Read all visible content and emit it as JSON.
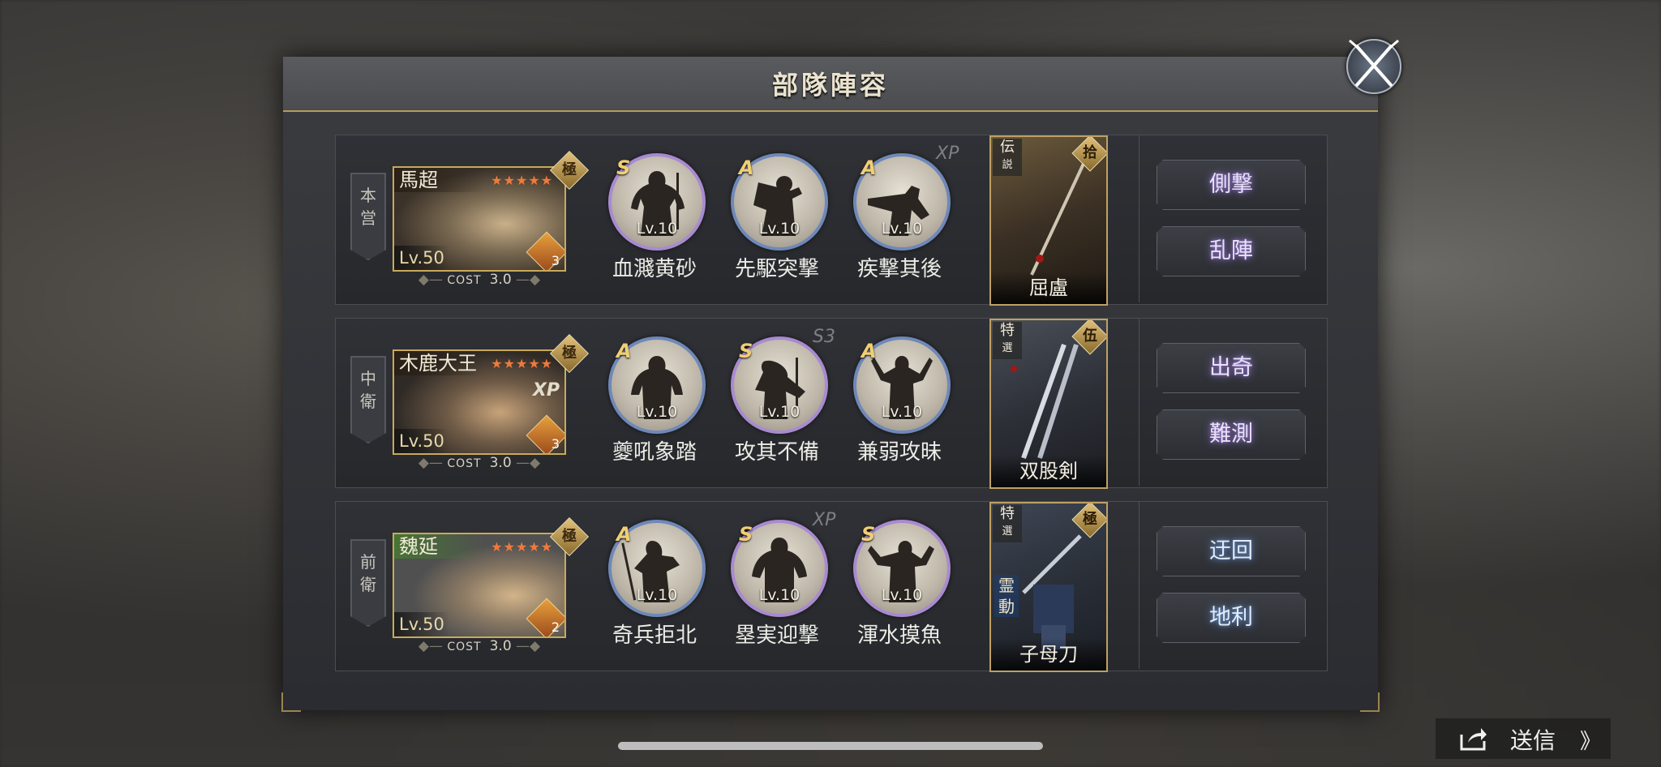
{
  "dialog": {
    "title": "部隊陣容"
  },
  "rows": [
    {
      "position": [
        "本",
        "営"
      ],
      "general": {
        "name": "馬超",
        "level": "Lv.50",
        "stars": "★★★★★",
        "rank_badge": "極",
        "rank_num": "3",
        "xp": "",
        "name_color": "#5a3a22"
      },
      "cost": {
        "label": "COST",
        "value": "3.0"
      },
      "skills": [
        {
          "grade": "S",
          "level": "Lv.10",
          "name": "血濺黄砂"
        },
        {
          "grade": "A",
          "level": "Lv.10",
          "name": "先駆突撃"
        },
        {
          "grade": "A",
          "level": "Lv.10",
          "name": "疾撃其後"
        }
      ],
      "skill_note": "XP",
      "weapon": {
        "name": "屈盧",
        "type_top": "伝",
        "type_bottom": "説",
        "rank": "拾",
        "extra": ""
      },
      "tactics": [
        "側撃",
        "乱陣"
      ]
    },
    {
      "position": [
        "中",
        "衛"
      ],
      "general": {
        "name": "木鹿大王",
        "level": "Lv.50",
        "stars": "★★★★★",
        "rank_badge": "極",
        "rank_num": "3",
        "xp": "XP"
      },
      "cost": {
        "label": "COST",
        "value": "3.0"
      },
      "skills": [
        {
          "grade": "A",
          "level": "Lv.10",
          "name": "夔吼象踏"
        },
        {
          "grade": "S",
          "level": "Lv.10",
          "name": "攻其不備"
        },
        {
          "grade": "A",
          "level": "Lv.10",
          "name": "兼弱攻昧"
        }
      ],
      "skill_note": "S3",
      "weapon": {
        "name": "双股剣",
        "type_top": "特",
        "type_bottom": "選",
        "rank": "伍",
        "extra": ""
      },
      "tactics": [
        "出奇",
        "難測"
      ]
    },
    {
      "position": [
        "前",
        "衛"
      ],
      "general": {
        "name": "魏延",
        "level": "Lv.50",
        "stars": "★★★★★",
        "rank_badge": "極",
        "rank_num": "2",
        "xp": ""
      },
      "cost": {
        "label": "COST",
        "value": "3.0"
      },
      "skills": [
        {
          "grade": "A",
          "level": "Lv.10",
          "name": "奇兵拒北"
        },
        {
          "grade": "S",
          "level": "Lv.10",
          "name": "塁実迎撃"
        },
        {
          "grade": "S",
          "level": "Lv.10",
          "name": "渾水摸魚"
        }
      ],
      "skill_note": "XP",
      "weapon": {
        "name": "子母刀",
        "type_top": "特",
        "type_bottom": "選",
        "rank": "極",
        "extra": "霊動"
      },
      "tactics": [
        "迂回",
        "地利"
      ]
    }
  ],
  "send": {
    "label": "送信",
    "arrow": "》"
  },
  "colors": {
    "accent_gold": "#c9a95a",
    "skill_s_ring": "#a98ad0",
    "skill_a_ring": "#6f88b8",
    "tactic_glow_purple": "#9d7fd6",
    "tactic_glow_blue": "#6f9bd6"
  },
  "icons": {
    "close": "crossed-swords-icon",
    "send": "share-icon"
  }
}
